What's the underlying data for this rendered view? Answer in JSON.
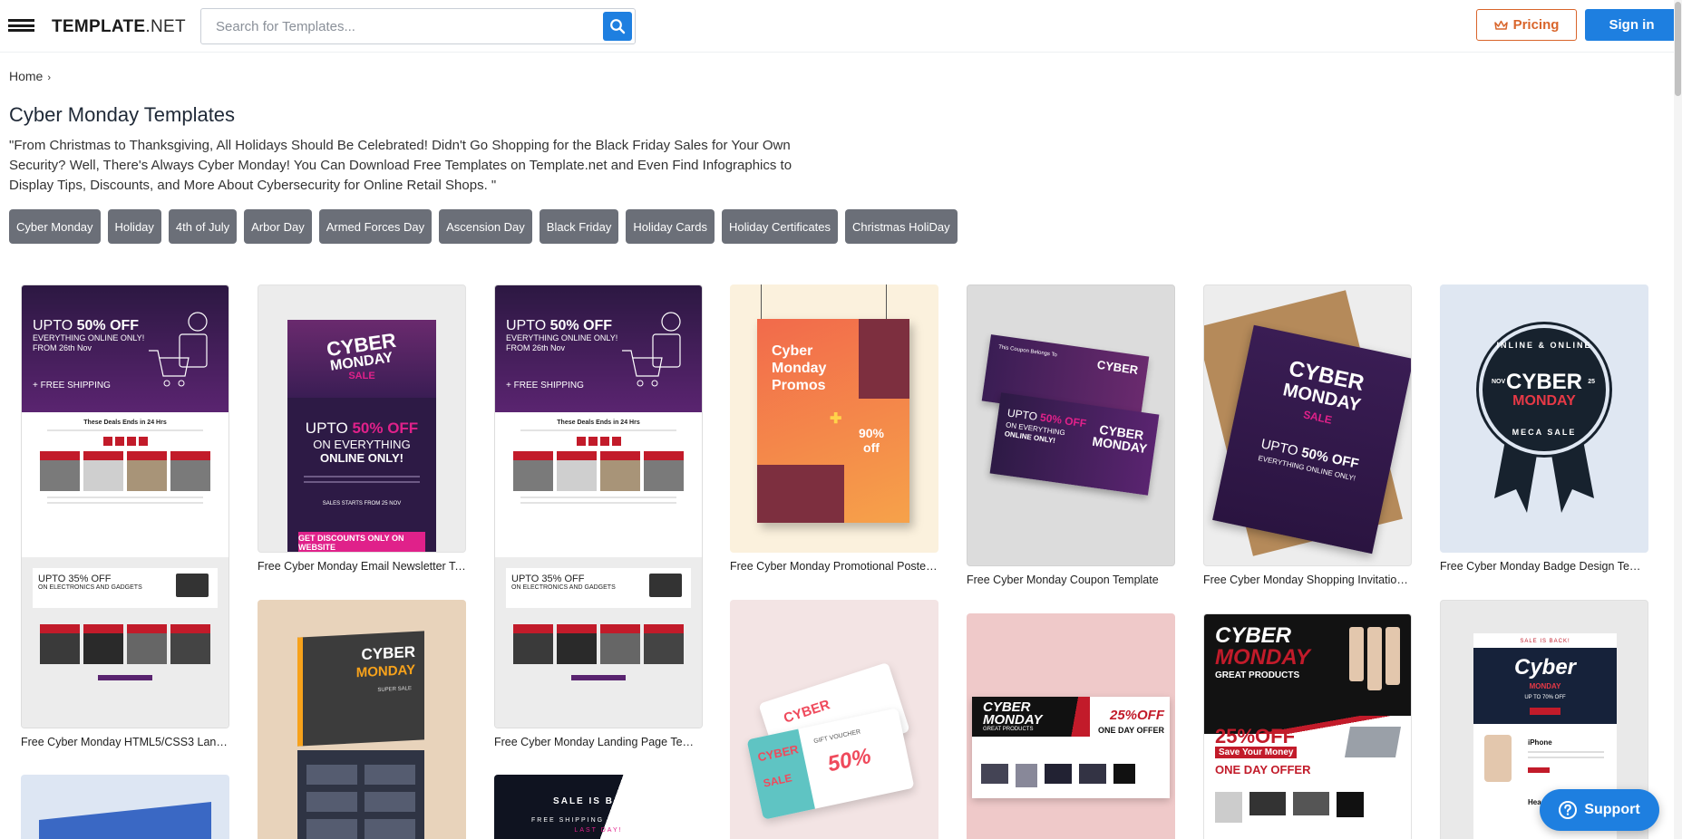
{
  "header": {
    "logo_bold": "TEMPLATE",
    "logo_light": ".NET",
    "search_placeholder": "Search for Templates...",
    "pricing_label": "Pricing",
    "signin_label": "Sign in"
  },
  "breadcrumb": {
    "home": "Home",
    "separator": "›"
  },
  "page": {
    "title": "Cyber Monday Templates",
    "description": "\"From Christmas to Thanksgiving, All Holidays Should Be Celebrated! Didn't Go Shopping for the Black Friday Sales for Your Own Security? Well, There's Always Cyber Monday! You Can Download Free Templates on Template.net and Even Find Infographics to Display Tips, Discounts, and More About Cybersecurity for Online Retail Shops. \""
  },
  "tags": [
    "Cyber Monday",
    "Holiday",
    "4th of July",
    "Arbor Day",
    "Armed Forces Day",
    "Ascension Day",
    "Black Friday",
    "Holiday Cards",
    "Holiday Certificates",
    "Christmas HoliDay"
  ],
  "cards": {
    "c1": "Free Cyber Monday HTML5/CSS3 Landin...",
    "c2": "Free Cyber Monday Email Newsletter Te...",
    "c3": "Free Cyber Monday Landing Page Templ...",
    "c4": "Free Cyber Monday Promotional Poster T...",
    "c5": "Free Cyber Monday Coupon Template",
    "c6": "Free Cyber Monday Shopping Invitation T...",
    "c7": "Free Cyber Monday Badge Design Templ..."
  },
  "thumb_text": {
    "upto": "UPTO",
    "fifty_off": "50% OFF",
    "everything_online": "EVERYTHING ONLINE ONLY!",
    "from_nov": "FROM 26th Nov",
    "free_shipping": "+ FREE SHIPPING",
    "deals_end": "These Deals Ends in 24 Hrs",
    "upto35": "UPTO 35% OFF",
    "electronics": "ON ELECTRONICS AND GADGETS",
    "cyber": "CYBER",
    "monday": "MONDAY",
    "sale": "SALE",
    "on_everything": "ON EVERYTHING",
    "online_only": "ONLINE ONLY!",
    "sales_starts": "SALES STARTS FROM 25 NOV",
    "get_discounts": "GET DISCOUNTS ONLY ON WEBSITE",
    "promo_title": "Cyber Monday Promos",
    "promo_pct": "90% off",
    "coupon_label": "This Coupon Belongs To",
    "badge_top": "INLINE & ONLINE",
    "badge_nov": "NOV",
    "badge_25": "25",
    "badge_bottom": "MECA SALE",
    "super_sale": "SUPER SALE",
    "gift_voucher": "GIFT VOUCHER",
    "voucher_pct": "50%",
    "great_products": "GREAT PRODUCTS",
    "pct25": "25%OFF",
    "save_money": "Save Your Money",
    "one_day": "ONE DAY OFFER",
    "sale_is_back": "SALE IS BACK!",
    "free_shipping_min": "FREE SHIPPING NO MINIMUM",
    "last_day": "LAST DAY!",
    "sale_back_small": "SALE IS BACK!",
    "cyber_script": "Cyber",
    "upto70": "UP TO 70% OFF",
    "iphone": "iPhone",
    "headphone": "Headphone"
  },
  "support_label": "Support",
  "colors": {
    "accent_blue": "#1e7fe0",
    "pricing_orange": "#d9652b",
    "tag_grey": "#6b6f78",
    "cyber_purple": "#3a1d54",
    "magenta": "#e0218a"
  }
}
